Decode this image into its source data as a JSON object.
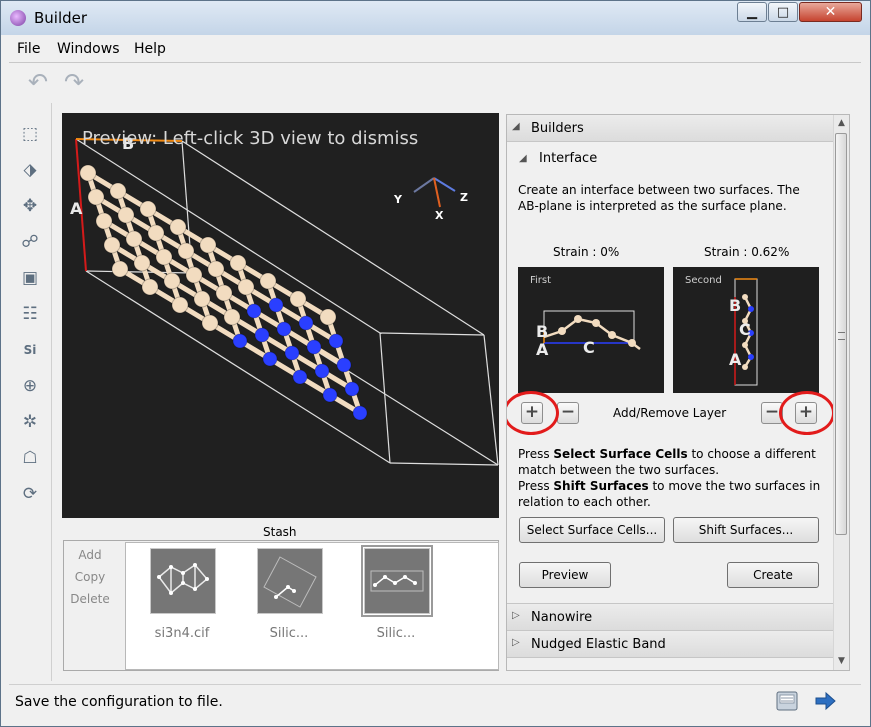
{
  "window": {
    "title": "Builder"
  },
  "menu": {
    "items": [
      "File",
      "Windows",
      "Help"
    ]
  },
  "toolbar": {
    "undo_icon": "undo-icon",
    "redo_icon": "redo-icon"
  },
  "sidebar": {
    "tools": [
      "select-rectangle-icon",
      "select-pointer-icon",
      "move-icon",
      "molecule-icon",
      "unit-cell-icon",
      "hierarchy-icon",
      "periodic-table-icon",
      "add-atom-icon",
      "plugin-icon",
      "ghost-icon",
      "rotate-icon"
    ]
  },
  "viewport": {
    "preview_text": "Preview: Left-click 3D view to dismiss",
    "axis_labels": {
      "y": "Y",
      "z": "Z",
      "x": "X"
    },
    "lattice_labels": {
      "a": "A",
      "b": "B"
    },
    "colors": {
      "background": "#202020",
      "silicon": "#f2dcc0",
      "nitrogen": "#2a3fff",
      "cell_edges": "#dedede",
      "a_vector": "#d41a1a",
      "b_vector": "#f08a14"
    }
  },
  "stash": {
    "title": "Stash",
    "actions": [
      "Add",
      "Copy",
      "Delete"
    ],
    "items": [
      {
        "label": "si3n4.cif"
      },
      {
        "label": "Silic..."
      },
      {
        "label": "Silic...",
        "selected": true
      }
    ]
  },
  "builders": {
    "header": "Builders",
    "interface": {
      "title": "Interface",
      "description": "Create an interface between two surfaces.  The AB-plane is interpreted as the surface plane.",
      "strain_first": "Strain :   0%",
      "strain_second": "Strain : 0.62%",
      "first_label": "First",
      "second_label": "Second",
      "first_atoms": {
        "b": "B",
        "a": "A",
        "c": "C"
      },
      "second_atoms": {
        "b": "B",
        "c": "C",
        "a": "A"
      },
      "layer_label": "Add/Remove Layer",
      "help_line1_prefix": "Press ",
      "help_line1_bold": "Select Surface Cells",
      "help_line1_rest": " to choose a different match between the two surfaces.",
      "help_line2_prefix": "Press ",
      "help_line2_bold": "Shift Surfaces",
      "help_line2_rest": " to move the two surfaces in relation to each other.",
      "select_cells_button": "Select Surface Cells...",
      "shift_surfaces_button": "Shift Surfaces...",
      "preview_button": "Preview",
      "create_button": "Create",
      "highlight_color": "#e21b1b"
    },
    "other_sections": [
      "Nanowire",
      "Nudged Elastic Band"
    ]
  },
  "status": {
    "text": "Save the configuration to file."
  }
}
